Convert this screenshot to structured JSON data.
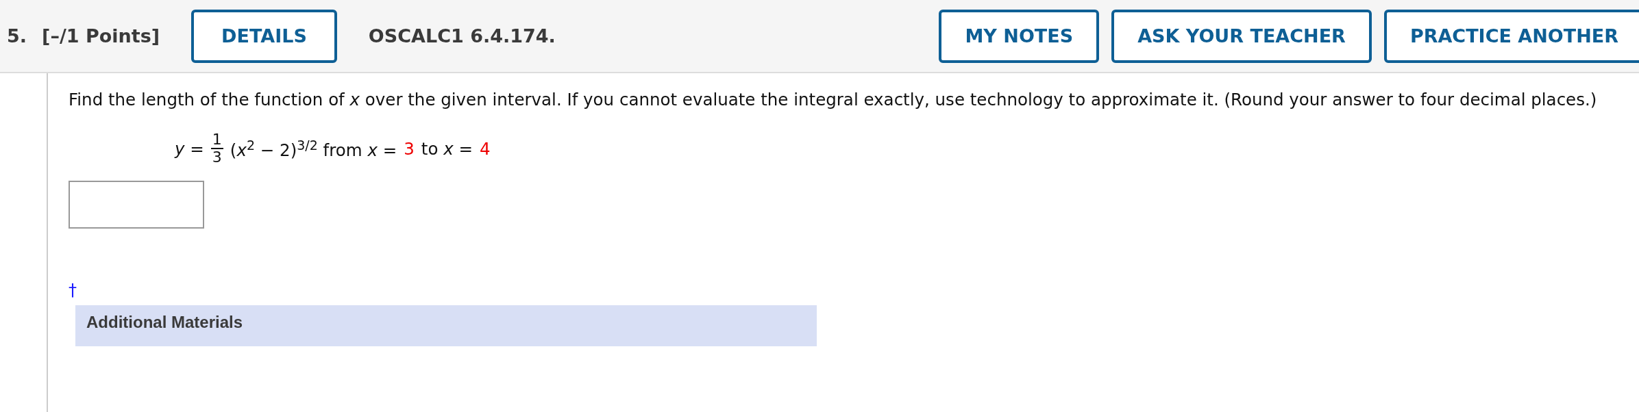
{
  "header": {
    "number": "5.",
    "points": "[–/1 Points]",
    "details_button": "DETAILS",
    "problem_id": "OSCALC1 6.4.174.",
    "action_buttons": [
      "MY NOTES",
      "ASK YOUR TEACHER",
      "PRACTICE ANOTHER"
    ]
  },
  "question": {
    "text": "Find the length of the function of *x* over the given interval. If you cannot evaluate the integral exactly, use technology to approximate it. (Round your answer to four decimal places.)",
    "equation": {
      "lhs": "*y* =",
      "numerator": "1",
      "denominator": "3",
      "expression": "(*x*$^{2}$ − 2)$^{3/2}$ from *x* =",
      "start": "3",
      "middle": "to *x* =",
      "end": "4"
    }
  },
  "footnote_mark": "†",
  "additional_materials": {
    "title": "Additional Materials"
  }
}
